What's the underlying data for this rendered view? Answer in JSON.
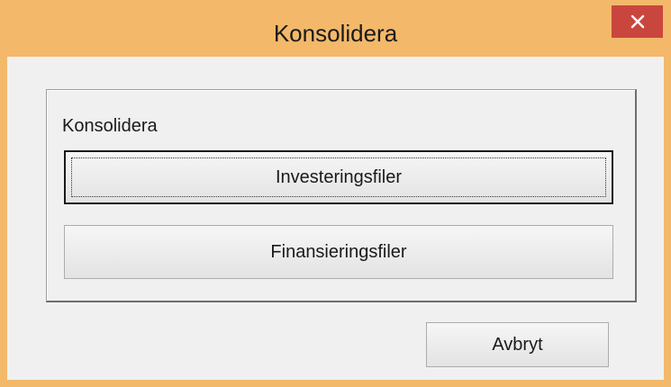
{
  "window": {
    "title": "Konsolidera",
    "close_icon": "close-icon"
  },
  "group": {
    "label": "Konsolidera",
    "buttons": {
      "investments_label": "Investeringsfiler",
      "financing_label": "Finansieringsfiler"
    }
  },
  "footer": {
    "cancel_label": "Avbryt"
  },
  "colors": {
    "titlebar": "#f4b86a",
    "close_button": "#c9463e",
    "client_background": "#f0f0f0"
  }
}
